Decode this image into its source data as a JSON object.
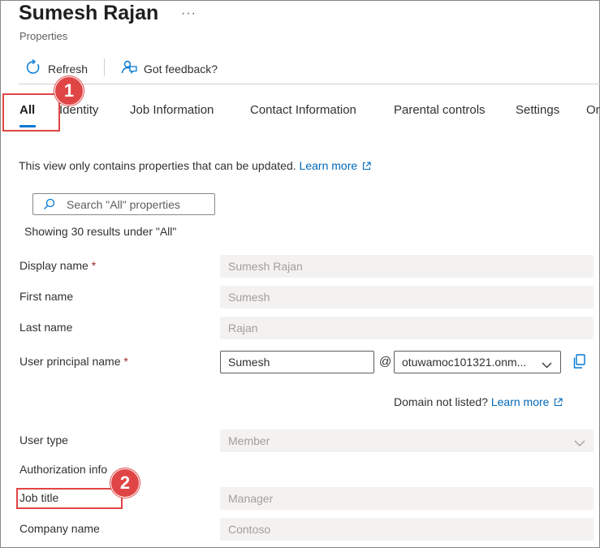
{
  "header": {
    "title": "Sumesh Rajan",
    "more": "···",
    "subtitle": "Properties"
  },
  "toolbar": {
    "refresh_label": "Refresh",
    "feedback_label": "Got feedback?"
  },
  "tabs": [
    {
      "label": "All",
      "active": true
    },
    {
      "label": "Identity"
    },
    {
      "label": "Job Information"
    },
    {
      "label": "Contact Information"
    },
    {
      "label": "Parental controls"
    },
    {
      "label": "Settings"
    },
    {
      "label": "On"
    }
  ],
  "annotations": {
    "badge_1": "1",
    "badge_2": "2"
  },
  "info": {
    "text": "This view only contains properties that can be updated.",
    "learn_more": "Learn more"
  },
  "search": {
    "placeholder": "Search \"All\" properties",
    "results_text": "Showing 30 results under \"All\""
  },
  "form": {
    "required_marker": "*",
    "display_name": {
      "label": "Display name",
      "value": "Sumesh Rajan"
    },
    "first_name": {
      "label": "First name",
      "value": "Sumesh"
    },
    "last_name": {
      "label": "Last name",
      "value": "Rajan"
    },
    "upn": {
      "label": "User principal name",
      "value": "Sumesh",
      "at": "@",
      "domain": "otuwamoc101321.onm..."
    },
    "domain_not_listed": "Domain not listed?",
    "domain_learn_more": "Learn more",
    "user_type": {
      "label": "User type",
      "value": "Member"
    },
    "authorization_info": "Authorization info",
    "job_title": {
      "label": "Job title",
      "value": "Manager"
    },
    "company_name": {
      "label": "Company name",
      "value": "Contoso"
    }
  },
  "colors": {
    "accent": "#0078d4",
    "link": "#0067b8",
    "required": "#a4262c",
    "annotation": "#e04545"
  }
}
